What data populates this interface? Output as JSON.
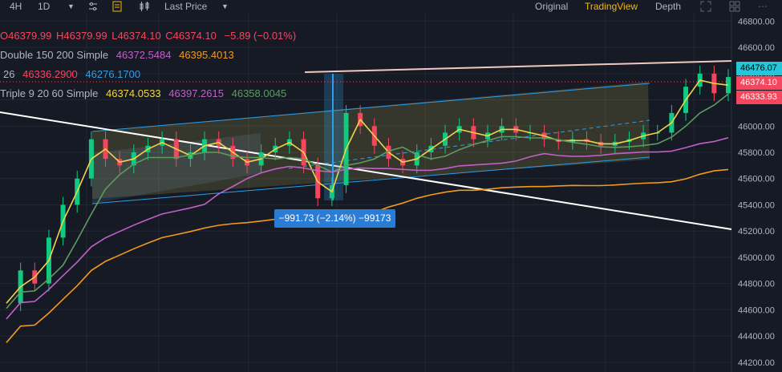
{
  "toolbar": {
    "interval": "4H",
    "range": "1D",
    "price_type": "Last Price",
    "views": [
      "Original",
      "TradingView",
      "Depth"
    ],
    "active_view": "TradingView"
  },
  "legend": {
    "ohlc": {
      "o": "O46379.99",
      "h": "H46379.99",
      "l": "L46374.10",
      "c": "C46374.10",
      "change": "−5.89 (−0.01%)"
    },
    "double": {
      "label": "Double 150 200 Simple",
      "v1": "46372.5484",
      "v2": "46395.4013"
    },
    "line3": {
      "label": "26",
      "v1": "46336.2900",
      "v2": "46276.1700"
    },
    "triple": {
      "label": "Triple 9 20 60 Simple",
      "v1": "46374.0533",
      "v2": "46397.2615",
      "v3": "46358.0045"
    }
  },
  "price_tags": {
    "cyan": "46476.07",
    "last": "46374.10",
    "low": "46333.93"
  },
  "measure": {
    "text": "−991.73 (−2.14%) −99173"
  },
  "colors": {
    "background": "#161a25",
    "up": "#0ecb81",
    "down": "#f6465d",
    "accent": "#f0b90b",
    "ma_yellow": "#f0d44a",
    "ma_green": "#5d9b5e",
    "ma_purple": "#c060c8",
    "ma_orange": "#f39a1e",
    "channel": "#2f9ee8",
    "measure": "#2a7cd4"
  },
  "chart_data": {
    "type": "line",
    "series": [
      {
        "name": "",
        "values": [
          44650,
          44900,
          44800,
          45150,
          45400,
          45600,
          45900,
          45750,
          45700,
          45800,
          45850,
          45900,
          45750,
          45800,
          45900,
          45850,
          45750,
          45700,
          45800,
          45850,
          45900,
          45700,
          45450,
          45550,
          46100,
          46000,
          45850,
          45750,
          45700,
          45800,
          45850,
          45950,
          46000,
          45900,
          45950,
          46000,
          45950,
          45950,
          45900,
          45880,
          45900,
          45880,
          45850,
          45880,
          45900,
          45950,
          45950,
          46100,
          46300,
          46400,
          46250,
          46374
        ]
      }
    ],
    "ylim": [
      44150,
      46900
    ],
    "yticks": [
      "46800.00",
      "46600.00",
      "46400.00",
      "46200.00",
      "46000.00",
      "45800.00",
      "45600.00",
      "45400.00",
      "45200.00",
      "45000.00",
      "44800.00",
      "44600.00",
      "44400.00",
      "44200.00"
    ],
    "grid": true
  }
}
